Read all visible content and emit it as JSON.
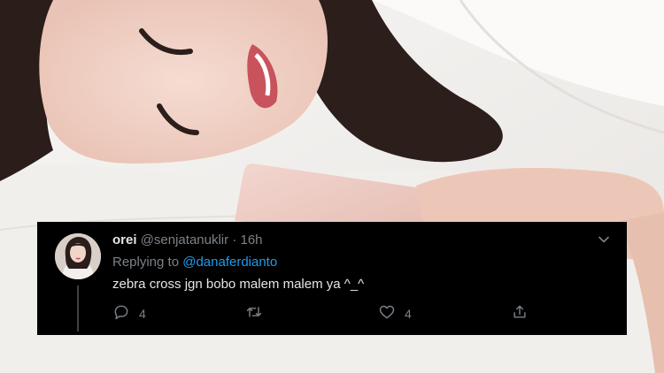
{
  "tweet": {
    "display_name": "orei",
    "handle": "@senjatanuklir",
    "separator": "·",
    "time": "16h",
    "replying_prefix": "Replying to",
    "replying_to": "@danaferdianto",
    "text": "zebra cross jgn bobo malem malem ya ^_^",
    "reply_count": "4",
    "like_count": "4"
  },
  "icons": {
    "reply": "reply-icon",
    "retweet": "retweet-icon",
    "like": "heart-icon",
    "share": "share-icon",
    "more": "chevron-down-icon"
  },
  "colors": {
    "card_background": "#000000",
    "mention": "#1d9bf0",
    "muted_text": "#7b8288"
  }
}
